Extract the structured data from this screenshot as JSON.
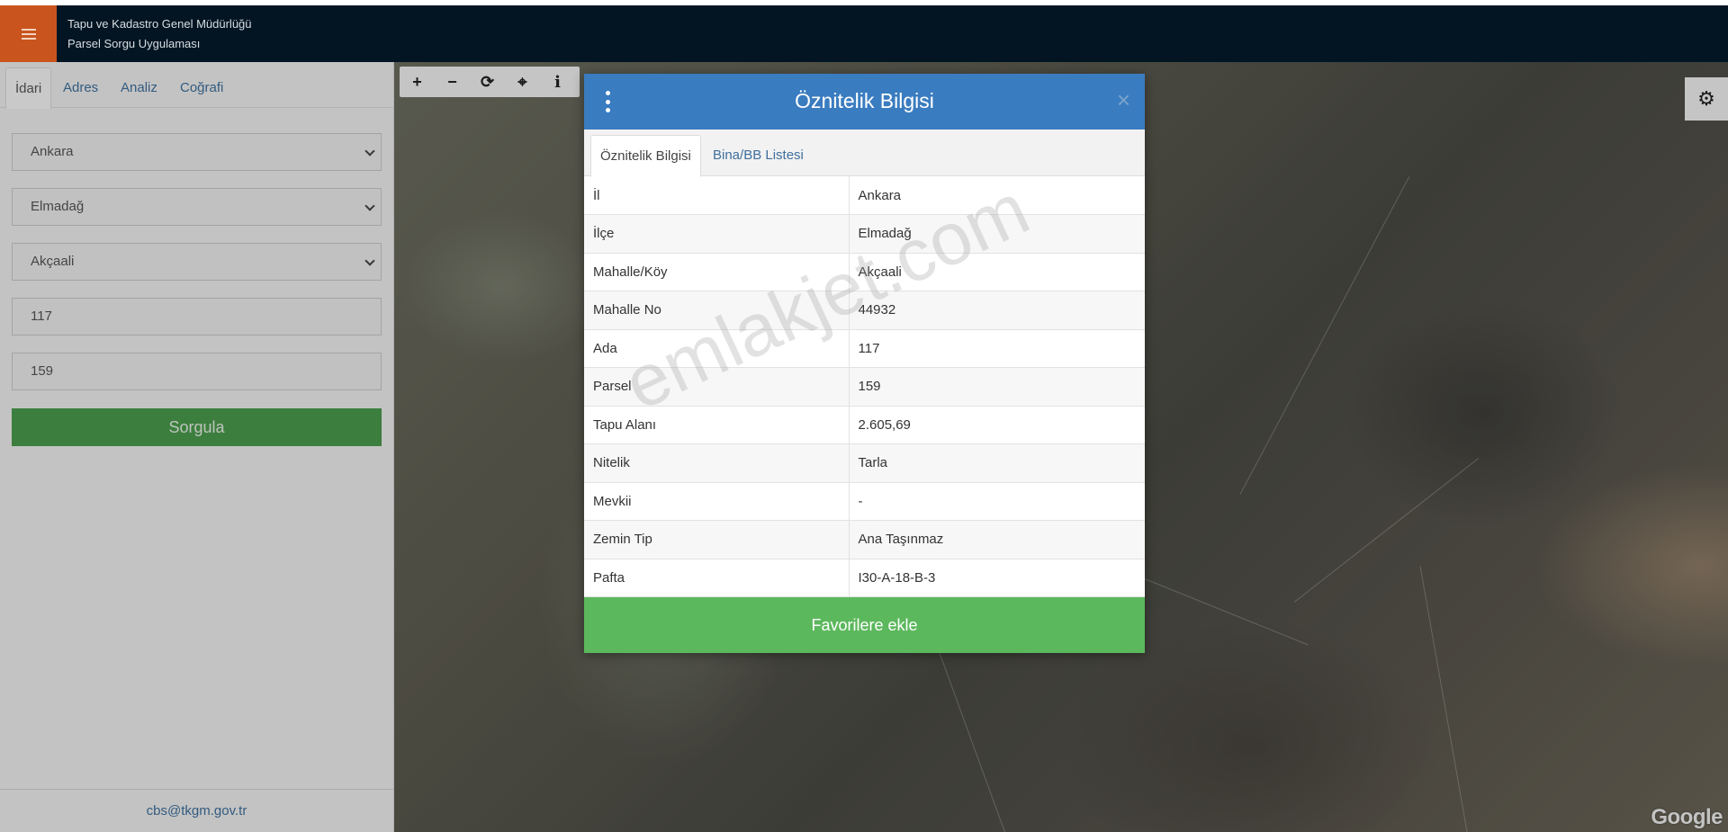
{
  "header": {
    "title_line1": "Tapu ve Kadastro Genel Müdürlüğü",
    "title_line2": "Parsel Sorgu Uygulaması"
  },
  "sidebar": {
    "tabs": [
      "İdari",
      "Adres",
      "Analiz",
      "Coğrafi"
    ],
    "active_tab": "İdari",
    "fields": {
      "il": "Ankara",
      "ilce": "Elmadağ",
      "mahalle": "Akçaali",
      "ada": "117",
      "parsel": "159"
    },
    "query_button": "Sorgula",
    "footer_email": "cbs@tkgm.gov.tr"
  },
  "map": {
    "toolbar_icons": [
      "zoom-in-icon",
      "zoom-out-icon",
      "refresh-icon",
      "locate-icon",
      "info-icon"
    ],
    "attribution": "Google"
  },
  "modal": {
    "title": "Öznitelik Bilgisi",
    "close": "×",
    "tabs": [
      "Öznitelik Bilgisi",
      "Bina/BB Listesi"
    ],
    "rows": [
      {
        "key": "İl",
        "value": "Ankara"
      },
      {
        "key": "İlçe",
        "value": "Elmadağ"
      },
      {
        "key": "Mahalle/Köy",
        "value": "Akçaali"
      },
      {
        "key": "Mahalle No",
        "value": "44932"
      },
      {
        "key": "Ada",
        "value": "117"
      },
      {
        "key": "Parsel",
        "value": "159"
      },
      {
        "key": "Tapu Alanı",
        "value": "2.605,69"
      },
      {
        "key": "Nitelik",
        "value": "Tarla"
      },
      {
        "key": "Mevkii",
        "value": "-"
      },
      {
        "key": "Zemin Tip",
        "value": "Ana Taşınmaz"
      },
      {
        "key": "Pafta",
        "value": "I30-A-18-B-3"
      }
    ],
    "favorite_button": "Favorilere ekle"
  },
  "watermark": "emlakjet.com",
  "colors": {
    "header_bg": "#031523",
    "menu_accent": "#c9541d",
    "modal_header": "#3a7cc0",
    "favorite_green": "#5cb85c",
    "query_green": "#4a9a4c",
    "link_blue": "#3f6f9c"
  }
}
